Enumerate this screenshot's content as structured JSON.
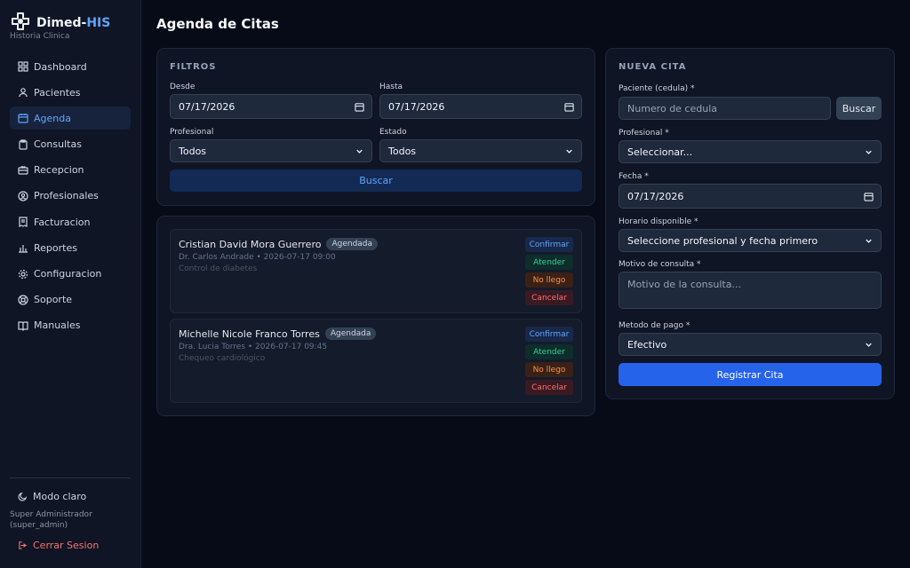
{
  "app": {
    "brand_prefix": "Dimed-",
    "brand_accent": "HIS",
    "subtitle": "Historia Clinica"
  },
  "sidebar": {
    "items": [
      {
        "label": "Dashboard",
        "icon": "grid-icon",
        "active": false
      },
      {
        "label": "Pacientes",
        "icon": "users-icon",
        "active": false
      },
      {
        "label": "Agenda",
        "icon": "calendar-icon",
        "active": true
      },
      {
        "label": "Consultas",
        "icon": "clipboard-icon",
        "active": false
      },
      {
        "label": "Recepcion",
        "icon": "reception-icon",
        "active": false
      },
      {
        "label": "Profesionales",
        "icon": "user-circle-icon",
        "active": false
      },
      {
        "label": "Facturacion",
        "icon": "receipt-icon",
        "active": false
      },
      {
        "label": "Reportes",
        "icon": "bar-chart-icon",
        "active": false
      },
      {
        "label": "Configuracion",
        "icon": "gear-icon",
        "active": false
      },
      {
        "label": "Soporte",
        "icon": "lifebuoy-icon",
        "active": false
      },
      {
        "label": "Manuales",
        "icon": "book-icon",
        "active": false
      }
    ],
    "mode_label": "Modo claro",
    "user_line1": "Super Administrador",
    "user_line2": "(super_admin)",
    "logout_label": "Cerrar Sesion"
  },
  "page": {
    "title": "Agenda de Citas"
  },
  "filters": {
    "title": "FILTROS",
    "desde_label": "Desde",
    "desde_value": "07/17/2026",
    "hasta_label": "Hasta",
    "hasta_value": "07/17/2026",
    "profesional_label": "Profesional",
    "profesional_value": "Todos",
    "estado_label": "Estado",
    "estado_value": "Todos",
    "search_button": "Buscar"
  },
  "appointments": [
    {
      "patient": "Cristian David Mora Guerrero",
      "status": "Agendada",
      "meta": "Dr. Carlos Andrade • 2026-07-17 09:00",
      "reason": "Control de diabetes"
    },
    {
      "patient": "Michelle Nicole Franco Torres",
      "status": "Agendada",
      "meta": "Dra. Lucia Torres • 2026-07-17 09:45",
      "reason": "Chequeo cardiológico"
    }
  ],
  "actions": {
    "confirm": "Confirmar",
    "attend": "Atender",
    "noshow": "No llego",
    "cancel": "Cancelar"
  },
  "new_appt": {
    "title": "NUEVA CITA",
    "patient_label": "Paciente (cedula) *",
    "patient_placeholder": "Numero de cedula",
    "search_button": "Buscar",
    "prof_label": "Profesional *",
    "prof_value": "Seleccionar...",
    "date_label": "Fecha *",
    "date_value": "07/17/2026",
    "slot_label": "Horario disponible *",
    "slot_value": "Seleccione profesional y fecha primero",
    "reason_label": "Motivo de consulta *",
    "reason_placeholder": "Motivo de la consulta...",
    "payment_label": "Metodo de pago *",
    "payment_value": "Efectivo",
    "submit_button": "Registrar Cita"
  },
  "colors": {
    "accent": "#2563eb",
    "accent_text": "#60a5fa",
    "background": "#070b17",
    "panel": "#0f1524"
  }
}
